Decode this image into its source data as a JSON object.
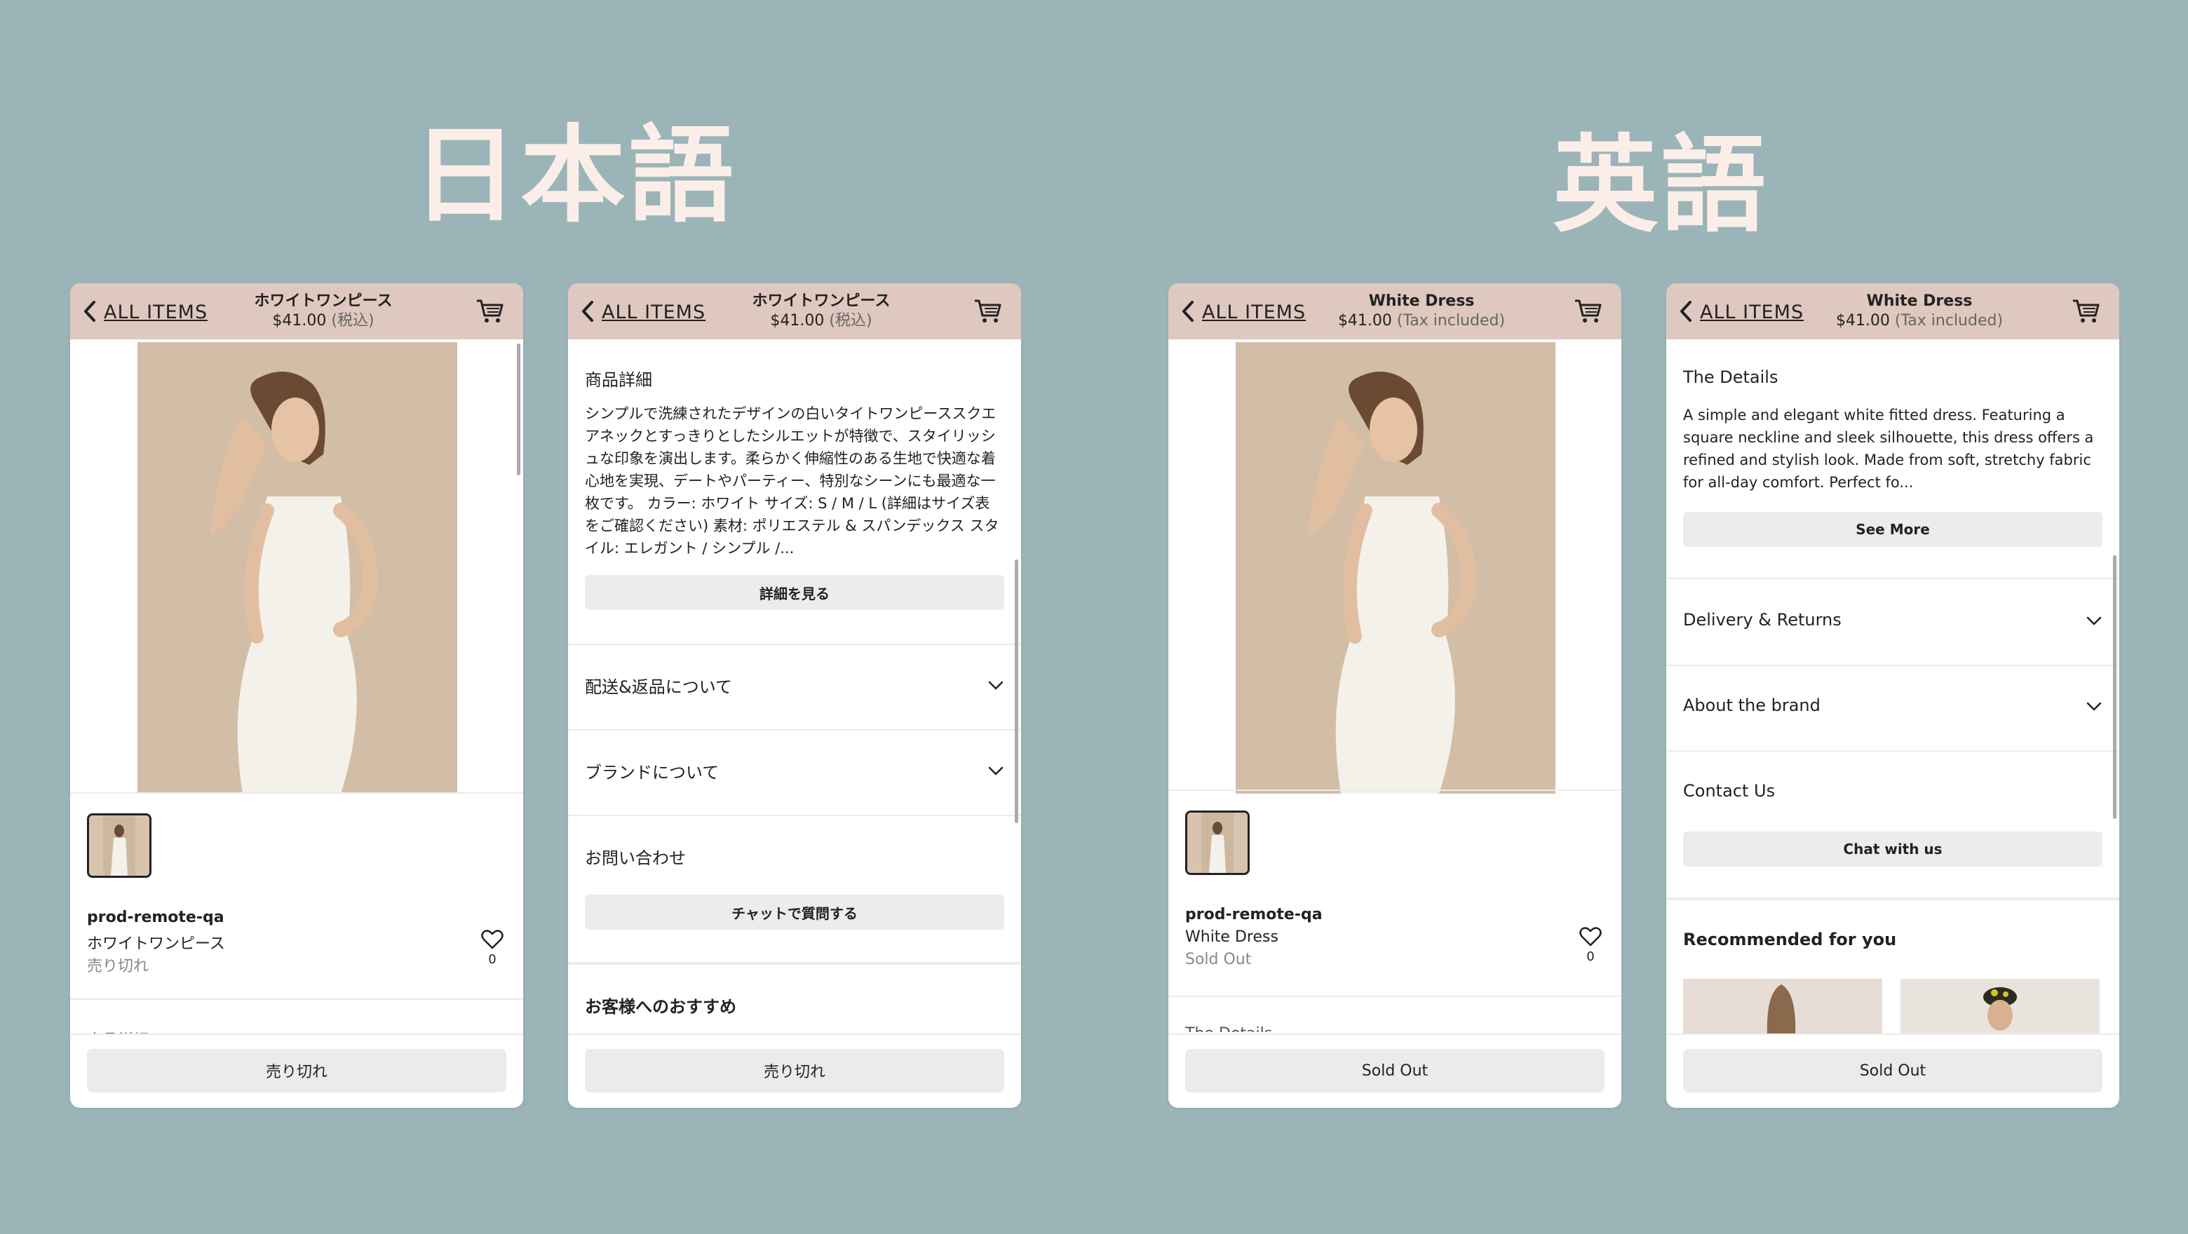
{
  "headings": {
    "japanese": "日本語",
    "english": "英語"
  },
  "common": {
    "back_label": "ALL ITEMS",
    "price": "$41.00",
    "vendor": "prod-remote-qa",
    "favorite_count": "0"
  },
  "ja": {
    "product_name": "ホワイトワンピース",
    "tax": "(税込)",
    "status": "売り切れ",
    "sold_out_button": "売り切れ",
    "details_title": "商品詳細",
    "description": "シンプルで洗練されたデザインの白いタイトワンピーススクエアネックとすっきりとしたシルエットが特徴で、スタイリッシュな印象を演出します。柔らかく伸縮性のある生地で快適な着心地を実現、デートやパーティー、特別なシーンにも最適な一枚です。 カラー: ホワイト サイズ: S / M / L (詳細はサイズ表をご確認ください) 素材: ポリエステル & スパンデックス スタイル: エレガント / シンプル /...",
    "see_more": "詳細を見る",
    "delivery": "配送&返品について",
    "about_brand": "ブランドについて",
    "contact": "お問い合わせ",
    "chat": "チャットで質問する",
    "recommended": "お客様へのおすすめ",
    "peek": "商品詳細"
  },
  "en": {
    "product_name": "White Dress",
    "tax": "(Tax included)",
    "status": "Sold Out",
    "sold_out_button": "Sold Out",
    "details_title": "The Details",
    "description": "A simple and elegant white fitted dress. Featuring a square neckline and sleek silhouette, this dress offers a refined and stylish look. Made from soft, stretchy fabric for all-day comfort. Perfect fo...",
    "see_more": "See More",
    "delivery": "Delivery & Returns",
    "about_brand": "About the brand",
    "contact": "Contact Us",
    "chat": "Chat with us",
    "recommended": "Recommended for you",
    "peek": "The Details"
  },
  "icons": [
    "chevron-left-icon",
    "cart-icon",
    "heart-icon",
    "chevron-down-icon"
  ],
  "colors": {
    "background": "#9bb4b7",
    "header": "#dfc8bf",
    "heading_text": "#fbeee9",
    "button_gray": "#ebebeb"
  }
}
